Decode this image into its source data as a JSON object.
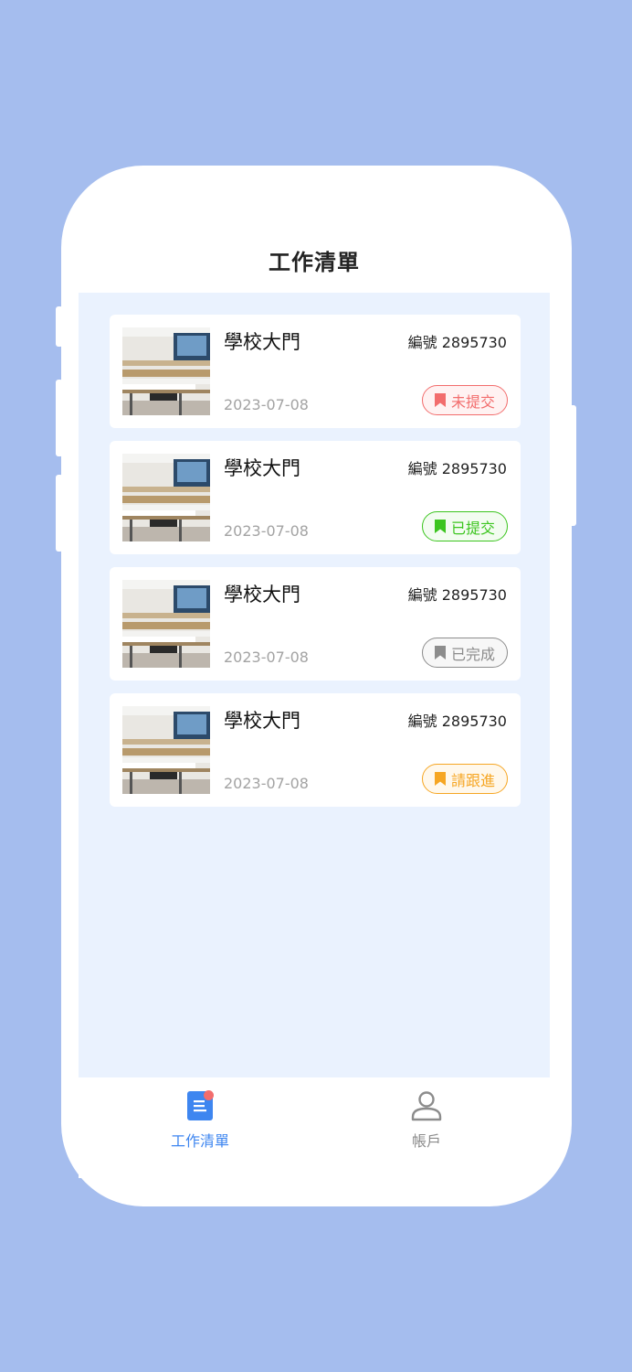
{
  "header": {
    "title": "工作清單"
  },
  "tasks": [
    {
      "title": "學校大門",
      "code": "編號 2895730",
      "date": "2023-07-08",
      "status": "未提交",
      "status_color": "#f26d6d"
    },
    {
      "title": "學校大門",
      "code": "編號 2895730",
      "date": "2023-07-08",
      "status": "已提交",
      "status_color": "#3cc51f"
    },
    {
      "title": "學校大門",
      "code": "編號 2895730",
      "date": "2023-07-08",
      "status": "已完成",
      "status_color": "#8c8c8c"
    },
    {
      "title": "學校大門",
      "code": "編號 2895730",
      "date": "2023-07-08",
      "status": "請跟進",
      "status_color": "#f6a623"
    }
  ],
  "tabbar": {
    "tabs": [
      {
        "label": "工作清單",
        "icon": "document-icon",
        "active": true
      },
      {
        "label": "帳戶",
        "icon": "user-icon",
        "active": false
      }
    ]
  },
  "colors": {
    "background": "#a5bdee",
    "accent": "#3e86f0",
    "content_bg": "#eaf2fe"
  }
}
